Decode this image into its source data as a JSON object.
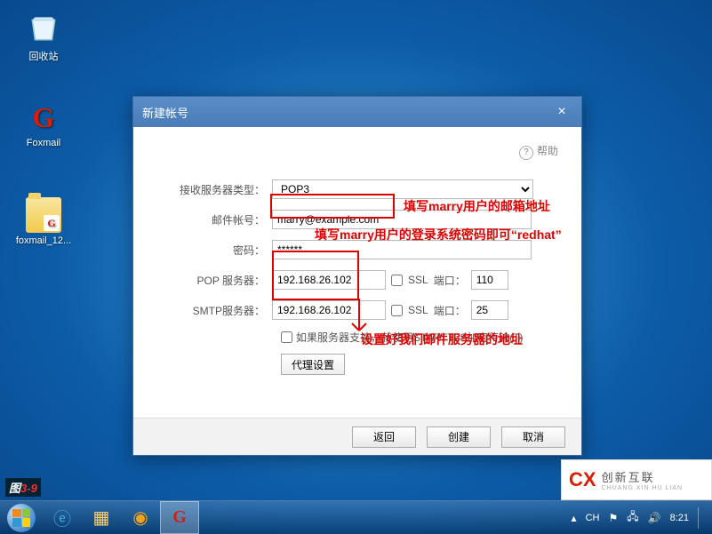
{
  "desktop": {
    "icons": {
      "recycle": "回收站",
      "foxmail": "Foxmail",
      "folder": "foxmail_12..."
    }
  },
  "dialog": {
    "title": "新建帐号",
    "help": "帮助",
    "labels": {
      "serverType": "接收服务器类型：",
      "mailAccount": "邮件帐号：",
      "password": "密码：",
      "pop": "POP 服务器：",
      "smtp": "SMTP服务器：",
      "ssl": "SSL",
      "port": "端口：",
      "starttls": "如果服务器支持，就使用STARTTLS加密传输(T)",
      "proxy": "代理设置"
    },
    "values": {
      "serverType": "POP3",
      "mailAccount": "marry@example.com",
      "password": "******",
      "pop": "192.168.26.102",
      "smtp": "192.168.26.102",
      "popPort": "110",
      "smtpPort": "25"
    },
    "buttons": {
      "back": "返回",
      "create": "创建",
      "cancel": "取消"
    }
  },
  "annotations": {
    "mail": "填写marry用户的邮箱地址",
    "pwd": "填写marry用户的登录系统密码即可“redhat”",
    "server": "设置好我们邮件服务器的地址",
    "figno_prefix": "图",
    "figno_num": "3-9"
  },
  "taskbar": {
    "tray": {
      "lang": "CH",
      "time": "8:21"
    }
  },
  "watermark": {
    "brand": "创新互联",
    "sub": "CHUANG XIN HU LIAN"
  }
}
